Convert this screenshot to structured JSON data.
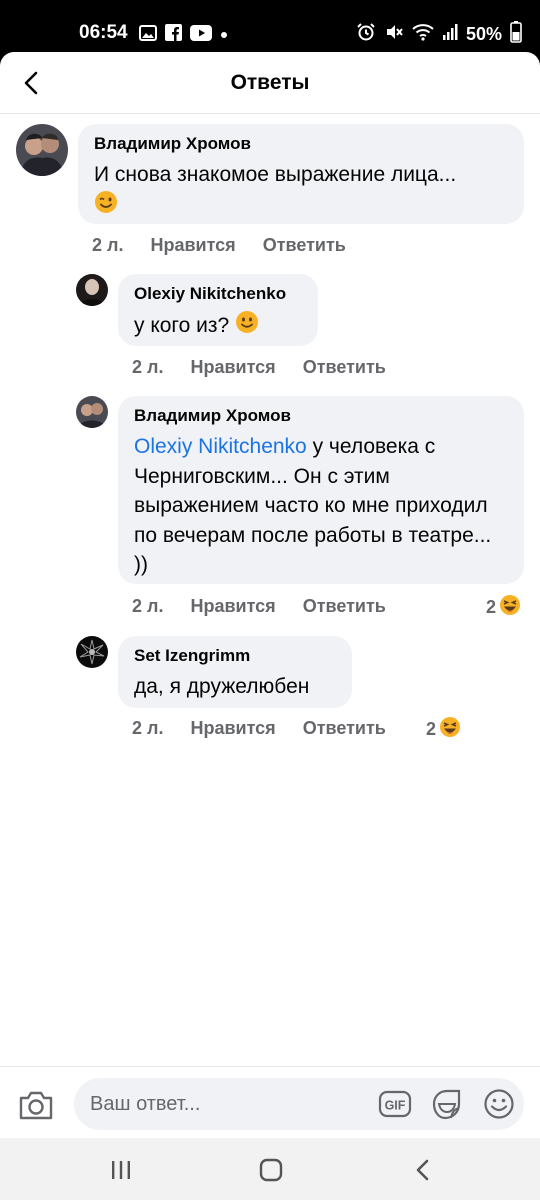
{
  "status_bar": {
    "time": "06:54",
    "battery": "50%",
    "left_icons": [
      "gallery-icon",
      "facebook-icon",
      "youtube-icon",
      "dot-icon"
    ],
    "right_icons": [
      "alarm-icon",
      "mute-icon",
      "wifi-icon",
      "signal-icon",
      "battery-icon"
    ]
  },
  "header": {
    "title": "Ответы"
  },
  "comments": [
    {
      "author": "Владимир Хромов",
      "text": "И снова знакомое выражение лица...",
      "emoji": "wink-emoji",
      "time": "2 л.",
      "like": "Нравится",
      "reply": "Ответить"
    },
    {
      "author": "Olexiy Nikitchenko",
      "text": "у кого из?",
      "emoji": "smile-emoji",
      "time": "2 л.",
      "like": "Нравится",
      "reply": "Ответить"
    },
    {
      "author": "Владимир Хромов",
      "mention": "Olexiy Nikitchenko",
      "text": " у человека с Черниговским... Он с этим выражением часто ко мне приходил по вечерам после работы в театре... ))",
      "time": "2 л.",
      "like": "Нравится",
      "reply": "Ответить",
      "reaction_count": "2",
      "reaction_emoji": "laughing-emoji"
    },
    {
      "author": "Set Izengrimm",
      "text": "да, я дружелюбен",
      "time": "2 л.",
      "like": "Нравится",
      "reply": "Ответить",
      "reaction_count": "2",
      "reaction_emoji": "laughing-emoji"
    }
  ],
  "composer": {
    "placeholder": "Ваш ответ...",
    "gif_label": "GIF"
  },
  "nav": [
    "recent-apps-icon",
    "home-icon",
    "back-icon"
  ],
  "colors": {
    "bubble": "#f0f2f5",
    "meta": "#65676b",
    "mention": "#1b74e4",
    "emoji_yellow": "#f7b125"
  }
}
